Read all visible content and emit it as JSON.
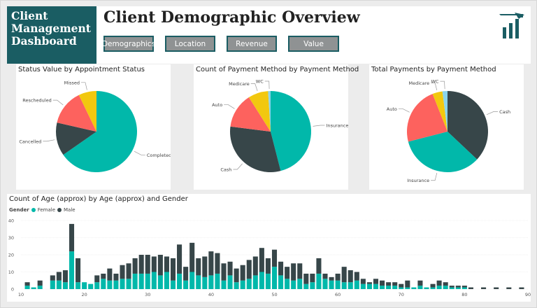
{
  "brand": {
    "line1": "Client",
    "line2": "Management",
    "line3": "Dashboard"
  },
  "title": "Client Demographic Overview",
  "nav": [
    "Demographics",
    "Location",
    "Revenue",
    "Value"
  ],
  "colors": {
    "teal": "#01b8aa",
    "dark": "#374649",
    "red": "#fd625e",
    "yellow": "#f2c80f",
    "gray": "#8ad4eb",
    "brand": "#1a5d63"
  },
  "chart_data": [
    {
      "type": "pie",
      "title": "Status Value by Appointment Status",
      "labels": [
        "Completed",
        "Cancelled",
        "Rescheduled",
        "Missed"
      ],
      "values": [
        64,
        13,
        14,
        7
      ]
    },
    {
      "type": "pie",
      "title": "Count of Payment Method by Payment Method",
      "labels": [
        "Insurance",
        "Cash",
        "Auto",
        "Medicare",
        "WC"
      ],
      "values": [
        46,
        31,
        14,
        8,
        1
      ]
    },
    {
      "type": "pie",
      "title": "Total Payments by Payment Method",
      "labels": [
        "Cash",
        "Insurance",
        "Auto",
        "Medicare",
        "WC"
      ],
      "values": [
        37,
        34,
        23,
        4,
        2
      ]
    },
    {
      "type": "bar",
      "stacked": true,
      "title": "Count of Age (approx) by Age (approx) and Gender",
      "legend_title": "Gender",
      "xlim": [
        10,
        90
      ],
      "ylim": [
        0,
        40
      ],
      "x_ticks": [
        10,
        20,
        30,
        40,
        50,
        60,
        70,
        80,
        90
      ],
      "y_ticks": [
        0,
        10,
        20,
        30,
        40
      ],
      "x": [
        11,
        12,
        13,
        15,
        16,
        17,
        18,
        19,
        20,
        21,
        22,
        23,
        24,
        25,
        26,
        27,
        28,
        29,
        30,
        31,
        32,
        33,
        34,
        35,
        36,
        37,
        38,
        39,
        40,
        41,
        42,
        43,
        44,
        45,
        46,
        47,
        48,
        49,
        50,
        51,
        52,
        53,
        54,
        55,
        56,
        57,
        58,
        59,
        60,
        61,
        62,
        63,
        64,
        65,
        66,
        67,
        68,
        69,
        70,
        71,
        72,
        73,
        74,
        75,
        76,
        77,
        78,
        79,
        80,
        81,
        83,
        85,
        87,
        89
      ],
      "series": [
        {
          "name": "Female",
          "values": [
            2,
            1,
            2,
            5,
            5,
            4,
            22,
            4,
            4,
            3,
            4,
            6,
            5,
            5,
            6,
            6,
            9,
            9,
            9,
            10,
            8,
            10,
            5,
            9,
            5,
            10,
            8,
            7,
            8,
            9,
            5,
            8,
            4,
            5,
            6,
            8,
            10,
            9,
            13,
            8,
            6,
            5,
            6,
            3,
            4,
            9,
            6,
            5,
            5,
            4,
            4,
            5,
            3,
            3,
            3,
            2,
            2,
            2,
            1,
            1,
            1,
            2,
            1,
            1,
            2,
            2,
            1,
            1,
            1,
            0,
            0,
            0,
            0,
            0
          ]
        },
        {
          "name": "Male",
          "values": [
            2,
            0,
            3,
            3,
            5,
            7,
            16,
            14,
            0,
            0,
            4,
            3,
            7,
            4,
            8,
            9,
            9,
            11,
            11,
            9,
            12,
            9,
            13,
            17,
            8,
            17,
            10,
            12,
            14,
            12,
            10,
            8,
            8,
            9,
            11,
            11,
            14,
            9,
            10,
            8,
            7,
            10,
            9,
            6,
            5,
            9,
            3,
            2,
            4,
            9,
            7,
            5,
            3,
            1,
            3,
            3,
            2,
            2,
            2,
            4,
            0,
            3,
            0,
            2,
            3,
            2,
            1,
            1,
            1,
            1,
            1,
            1,
            1,
            1
          ]
        }
      ]
    }
  ]
}
